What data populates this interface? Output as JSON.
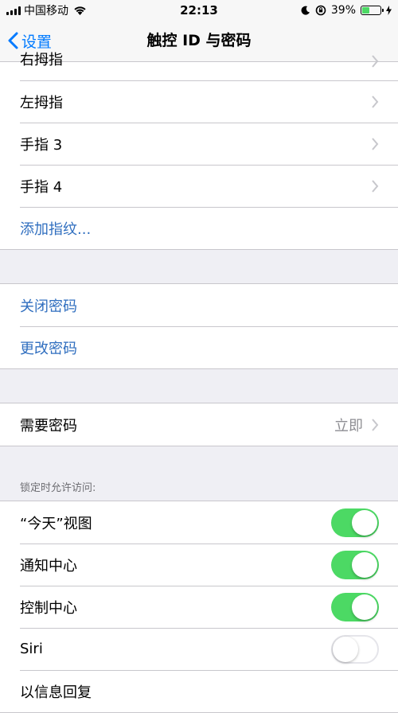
{
  "status": {
    "carrier": "中国移动",
    "time": "22:13",
    "battery": "39%",
    "battery_level": 0.39
  },
  "nav": {
    "back_label": "设置",
    "title": "触控 ID 与密码"
  },
  "fingers": [
    {
      "label": "右拇指"
    },
    {
      "label": "左拇指"
    },
    {
      "label": "手指 3"
    },
    {
      "label": "手指 4"
    }
  ],
  "add_fingerprint": "添加指纹...",
  "passcode": {
    "turn_off": "关闭密码",
    "change": "更改密码"
  },
  "require": {
    "label": "需要密码",
    "value": "立即"
  },
  "lock_access": {
    "header": "锁定时允许访问:",
    "items": [
      {
        "label": "“今天”视图",
        "on": true
      },
      {
        "label": "通知中心",
        "on": true
      },
      {
        "label": "控制中心",
        "on": true
      },
      {
        "label": "Siri",
        "on": false
      },
      {
        "label": "以信息回复",
        "on": null
      }
    ]
  },
  "colors": {
    "accent": "#007aff",
    "link": "#2f6ebf",
    "switch_on": "#4cd964",
    "background": "#efeff4"
  }
}
